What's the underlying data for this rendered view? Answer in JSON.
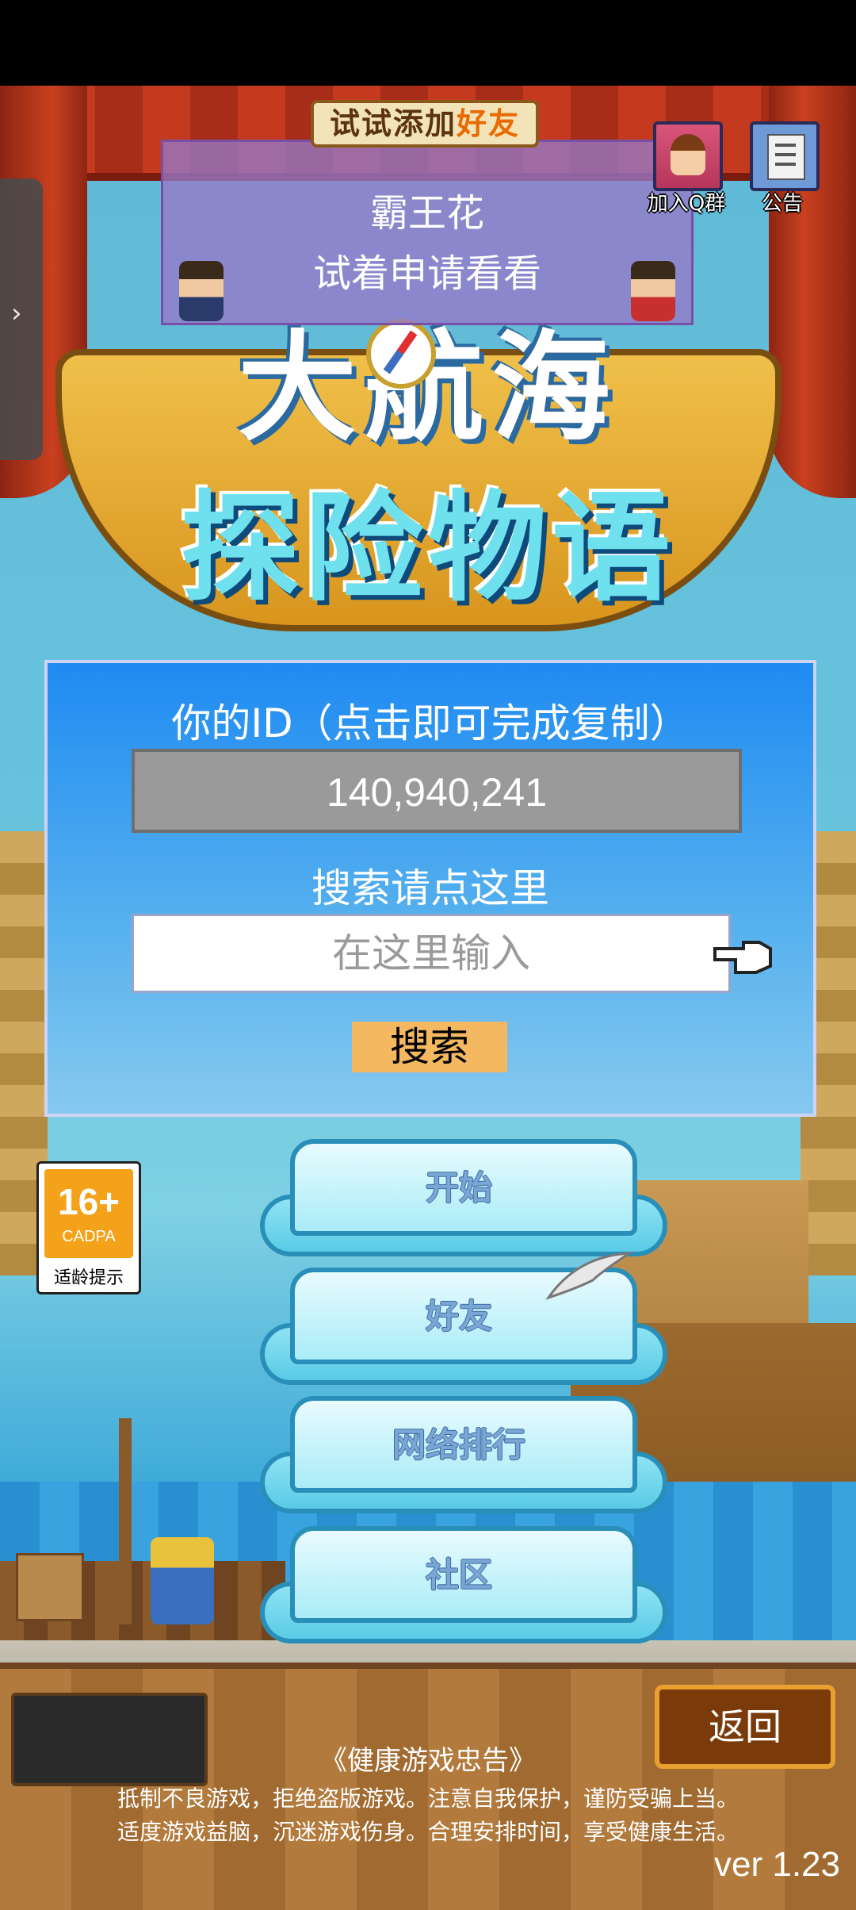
{
  "side_tab": {
    "icon": "chevron-right-icon",
    "glyph": "›"
  },
  "friend_tip": {
    "label_prefix": "试试添加",
    "label_highlight": "好友",
    "friend_name": "霸王花",
    "message": "试着申请看看"
  },
  "top_buttons": {
    "qgroup_label": "加入Q群",
    "notice_label": "公告"
  },
  "logo": {
    "line1": "大航海",
    "line2": "探险物语"
  },
  "id_panel": {
    "id_label": "你的ID（点击即可完成复制）",
    "id_value": "140,940,241",
    "search_label": "搜索请点这里",
    "search_placeholder": "在这里输入",
    "search_button": "搜索"
  },
  "age_badge": {
    "rating": "16+",
    "org": "CADPA",
    "hint": "适龄提示"
  },
  "menu": {
    "start": "开始",
    "friends": "好友",
    "ranking": "网络排行",
    "community": "社区"
  },
  "bottom": {
    "back_button": "返回",
    "health_title": "《健康游戏忠告》",
    "health_line1": "抵制不良游戏，拒绝盗版游戏。注意自我保护，谨防受骗上当。",
    "health_line2": "适度游戏益脑，沉迷游戏伤身。合理安排时间，享受健康生活。",
    "version": "ver 1.23"
  },
  "colors": {
    "panel_top": "#1f8bf2",
    "panel_bottom": "#86c9ef",
    "search_button": "#f4b860",
    "age_badge": "#f4a21a",
    "back_button_border": "#e8a030"
  }
}
